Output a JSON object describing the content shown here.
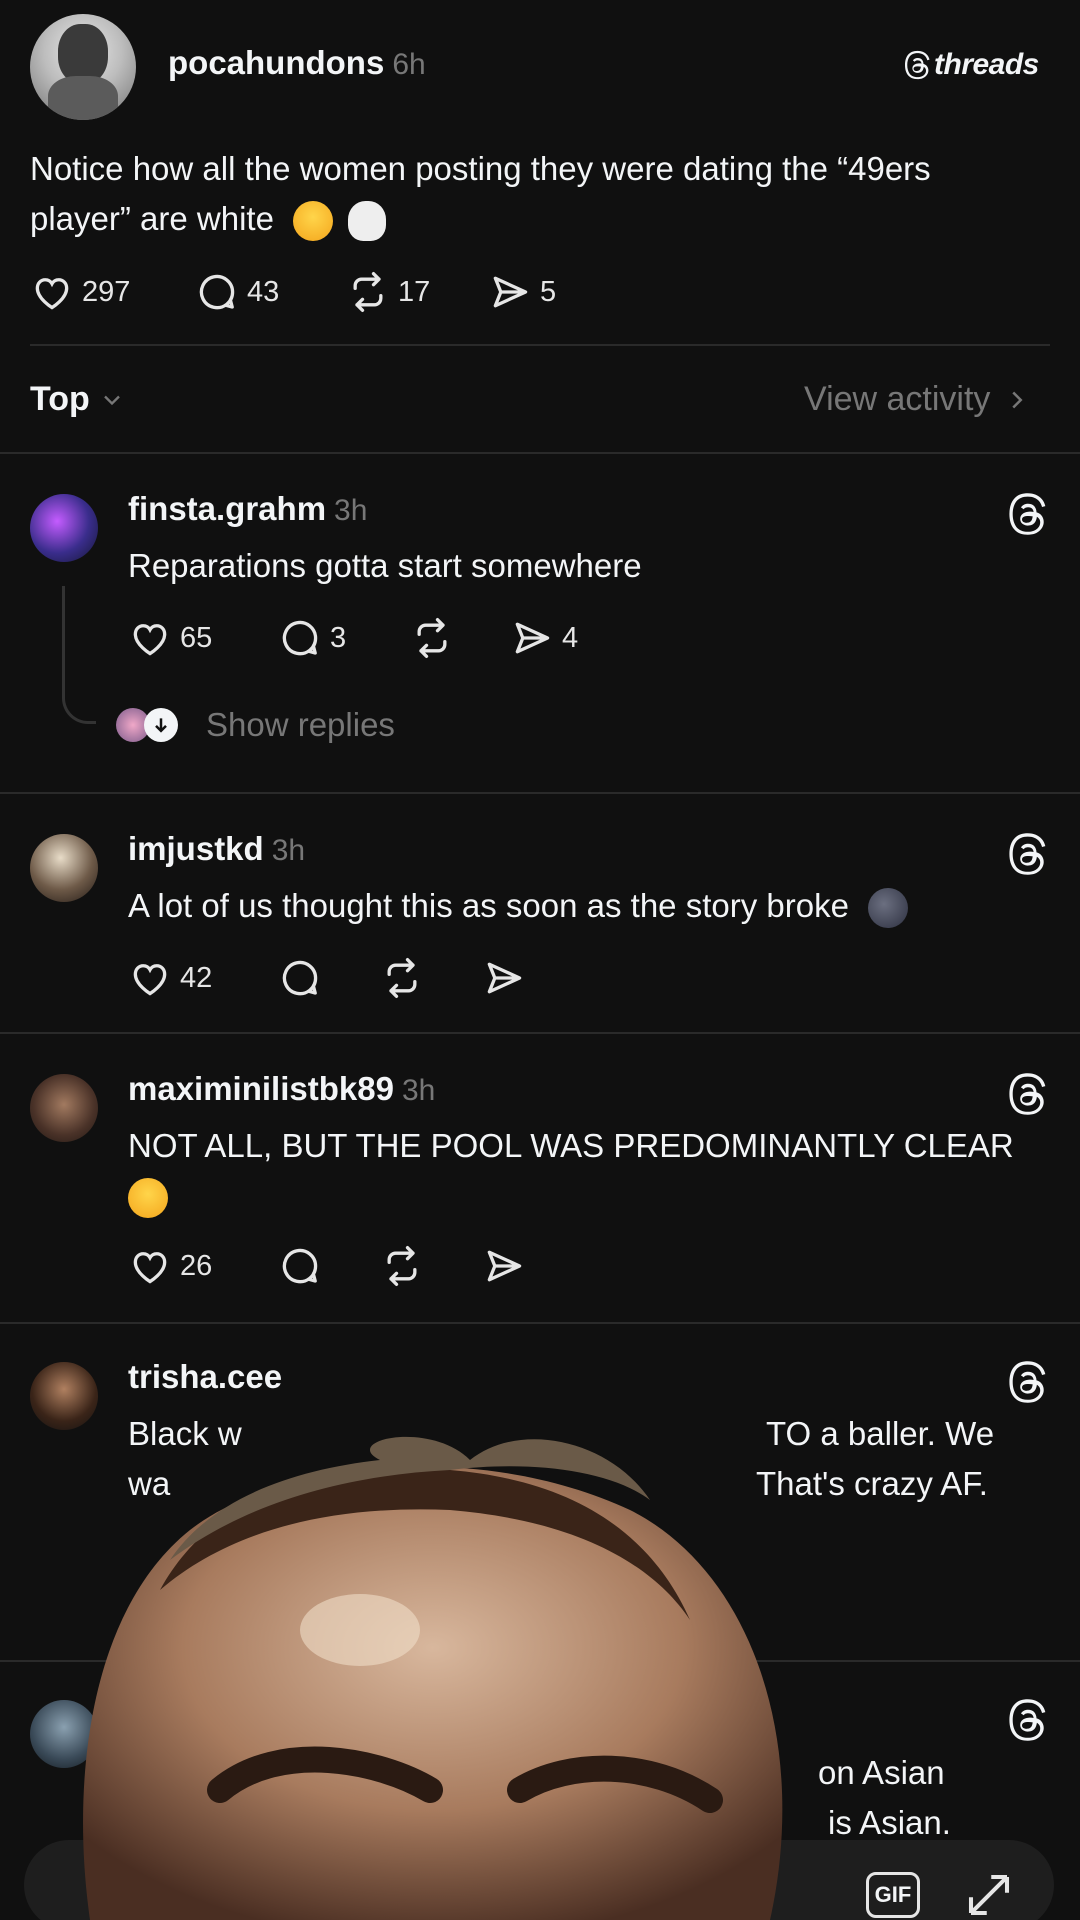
{
  "post": {
    "username": "pocahundons",
    "time": "6h",
    "brand": "threads",
    "text": "Notice how all the women posting they were dating the “49ers player” are white",
    "text_line1": "Notice how all the women posting they were dating the “49ers",
    "text_line2": "player” are white",
    "likes": "297",
    "replies": "43",
    "reposts": "17",
    "shares": "5"
  },
  "sort": {
    "label": "Top",
    "activity_link": "View activity"
  },
  "comments": [
    {
      "username": "finsta.grahm",
      "time": "3h",
      "text": "Reparations gotta start somewhere",
      "likes": "65",
      "replies": "3",
      "shares": "4",
      "show_replies": "Show replies"
    },
    {
      "username": "imjustkd",
      "time": "3h",
      "text": "A lot of us thought this as soon as the story broke",
      "likes": "42"
    },
    {
      "username": "maximinilistbk89",
      "time": "3h",
      "text": "NOT ALL, BUT THE POOL WAS PREDOMINANTLY CLEAR",
      "likes": "26"
    },
    {
      "username": "trisha.cee",
      "time": "",
      "text_a": "Black w",
      "text_b": "TO a baller. We",
      "text_c": "wa",
      "text_d": "That's crazy AF."
    },
    {
      "username": "",
      "text_a": "on Asian",
      "text_b": "is Asian."
    }
  ],
  "composer": {
    "gif_label": "GIF"
  },
  "icons": [
    "heart-icon",
    "comment-icon",
    "repost-icon",
    "share-icon",
    "threads-logo-icon",
    "chevron-down-icon",
    "chevron-right-icon",
    "expand-icon"
  ],
  "colors": {
    "background": "#101010",
    "text": "#f3f5f7",
    "muted": "#777777",
    "divider": "#2a2a2a"
  }
}
